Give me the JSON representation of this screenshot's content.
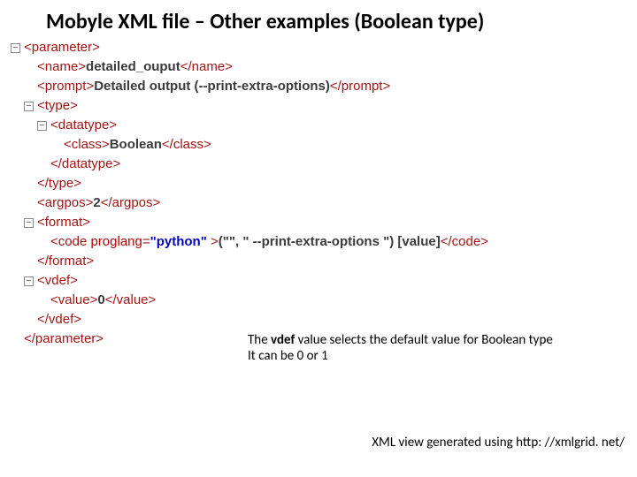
{
  "title": "Mobyle XML file – Other examples (Boolean type)",
  "xml": {
    "parameter_open": "<parameter>",
    "name_open": "<name>",
    "name_text": "detailed_ouput",
    "name_close": "</name>",
    "prompt_open": "<prompt>",
    "prompt_text": "Detailed output (--print-extra-options)",
    "prompt_close": "</prompt>",
    "type_open": "<type>",
    "datatype_open": "<datatype>",
    "class_open": "<class>",
    "class_text": "Boolean",
    "class_close": "</class>",
    "datatype_close": "</datatype>",
    "type_close": "</type>",
    "argpos_open": "<argpos>",
    "argpos_text": "2",
    "argpos_close": "</argpos>",
    "format_open": "<format>",
    "code_open_lt": "<code ",
    "code_attr_name": "proglang",
    "code_attr_eq": "=",
    "code_attr_val": "\"python\"",
    "code_open_gt": " >",
    "code_text": "(\"\", \" --print-extra-options \") [value]",
    "code_close": "</code>",
    "format_close": "</format>",
    "vdef_open": "<vdef>",
    "value_open": "<value>",
    "value_text": "0",
    "value_close": "</value>",
    "vdef_close": "</vdef>",
    "parameter_close": "</parameter>"
  },
  "note_line1_pre": "The ",
  "note_line1_bold": "vdef",
  "note_line1_post": " value selects the default value for Boolean type",
  "note_line2": "It can be 0 or 1",
  "footer": "XML view generated using http: //xmlgrid. net/"
}
